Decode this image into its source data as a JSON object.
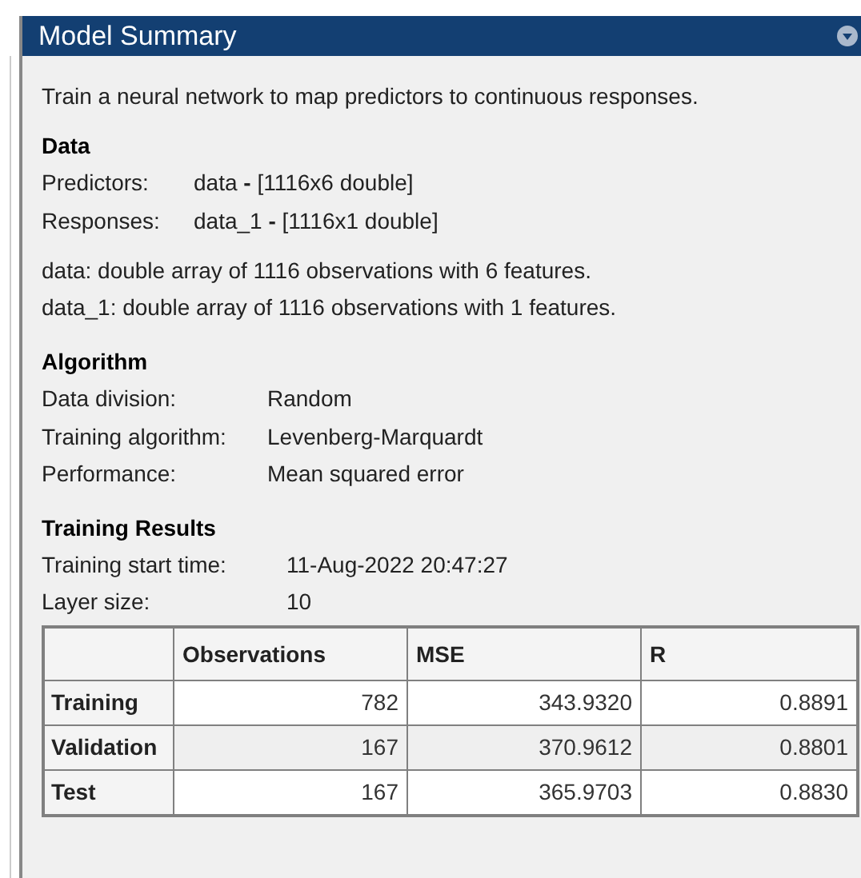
{
  "panel": {
    "title": "Model Summary",
    "expanded": true
  },
  "description": "Train a neural network to map predictors to continuous responses.",
  "data_section": {
    "heading": "Data",
    "fields": [
      {
        "label": "Predictors:",
        "value": "data **-** [1116x6 double]"
      },
      {
        "label": "Responses:",
        "value": "data_1 **-** [1116x1 double]"
      }
    ],
    "notes": [
      "data: double array of 1116 observations with 6 features.",
      "data_1: double array of 1116 observations with 1 features."
    ]
  },
  "algorithm_section": {
    "heading": "Algorithm",
    "fields": [
      {
        "label": "Data division:",
        "value": "Random"
      },
      {
        "label": "Training algorithm:",
        "value": "Levenberg-Marquardt"
      },
      {
        "label": "Performance:",
        "value": "Mean squared error"
      }
    ]
  },
  "results_section": {
    "heading": "Training Results",
    "fields": [
      {
        "label": "Training start time:",
        "value": "11-Aug-2022 20:47:27"
      },
      {
        "label": "Layer size:",
        "value": "10"
      }
    ]
  },
  "table": {
    "columns": [
      "Observations",
      "MSE",
      "R"
    ],
    "rows": [
      {
        "name": "Training",
        "cells": [
          "782",
          "343.9320",
          "0.8891"
        ]
      },
      {
        "name": "Validation",
        "cells": [
          "167",
          "370.9612",
          "0.8801"
        ]
      },
      {
        "name": "Test",
        "cells": [
          "167",
          "365.9703",
          "0.8830"
        ]
      }
    ]
  }
}
